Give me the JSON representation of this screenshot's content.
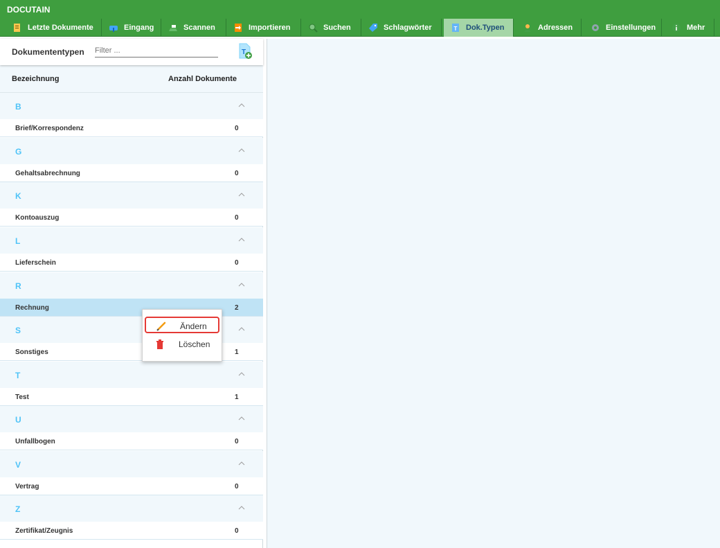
{
  "app": {
    "title": "DOCUTAIN"
  },
  "nav": {
    "items": [
      {
        "label": "Letzte Dokumente",
        "icon": "recent-documents-icon"
      },
      {
        "label": "Eingang",
        "icon": "mailbox-icon"
      },
      {
        "label": "Scannen",
        "icon": "scanner-icon"
      },
      {
        "label": "Importieren",
        "icon": "import-icon"
      },
      {
        "label": "Suchen",
        "icon": "search-icon"
      },
      {
        "label": "Schlagwörter",
        "icon": "tag-icon"
      },
      {
        "label": "Dok.Typen",
        "icon": "document-type-icon",
        "active": true
      },
      {
        "label": "Adressen",
        "icon": "person-icon"
      },
      {
        "label": "Einstellungen",
        "icon": "gear-icon"
      },
      {
        "label": "Mehr",
        "icon": "info-icon"
      }
    ]
  },
  "panel": {
    "title": "Dokumententypen",
    "filter_placeholder": "Filter ...",
    "add_icon": "add-document-type-icon",
    "columns": {
      "name": "Bezeichnung",
      "count": "Anzahl Dokumente"
    }
  },
  "groups": [
    {
      "letter": "B",
      "items": [
        {
          "name": "Brief/Korrespondenz",
          "count": "0"
        }
      ]
    },
    {
      "letter": "G",
      "items": [
        {
          "name": "Gehaltsabrechnung",
          "count": "0"
        }
      ]
    },
    {
      "letter": "K",
      "items": [
        {
          "name": "Kontoauszug",
          "count": "0"
        }
      ]
    },
    {
      "letter": "L",
      "items": [
        {
          "name": "Lieferschein",
          "count": "0"
        }
      ]
    },
    {
      "letter": "R",
      "items": [
        {
          "name": "Rechnung",
          "count": "2",
          "selected": true
        }
      ]
    },
    {
      "letter": "S",
      "items": [
        {
          "name": "Sonstiges",
          "count": "1"
        }
      ]
    },
    {
      "letter": "T",
      "items": [
        {
          "name": "Test",
          "count": "1"
        }
      ]
    },
    {
      "letter": "U",
      "items": [
        {
          "name": "Unfallbogen",
          "count": "0"
        }
      ]
    },
    {
      "letter": "V",
      "items": [
        {
          "name": "Vertrag",
          "count": "0"
        }
      ]
    },
    {
      "letter": "Z",
      "items": [
        {
          "name": "Zertifikat/Zeugnis",
          "count": "0"
        }
      ]
    }
  ],
  "context_menu": {
    "items": [
      {
        "label": "Ändern",
        "icon": "pencil-icon",
        "highlighted": true
      },
      {
        "label": "Löschen",
        "icon": "trash-icon"
      }
    ]
  },
  "colors": {
    "header_green": "#3f9e3f",
    "active_tab": "#a5d6a7",
    "group_letter": "#4fc3f7",
    "selected_row": "#bfe3f5",
    "highlight_border": "#e53935"
  }
}
